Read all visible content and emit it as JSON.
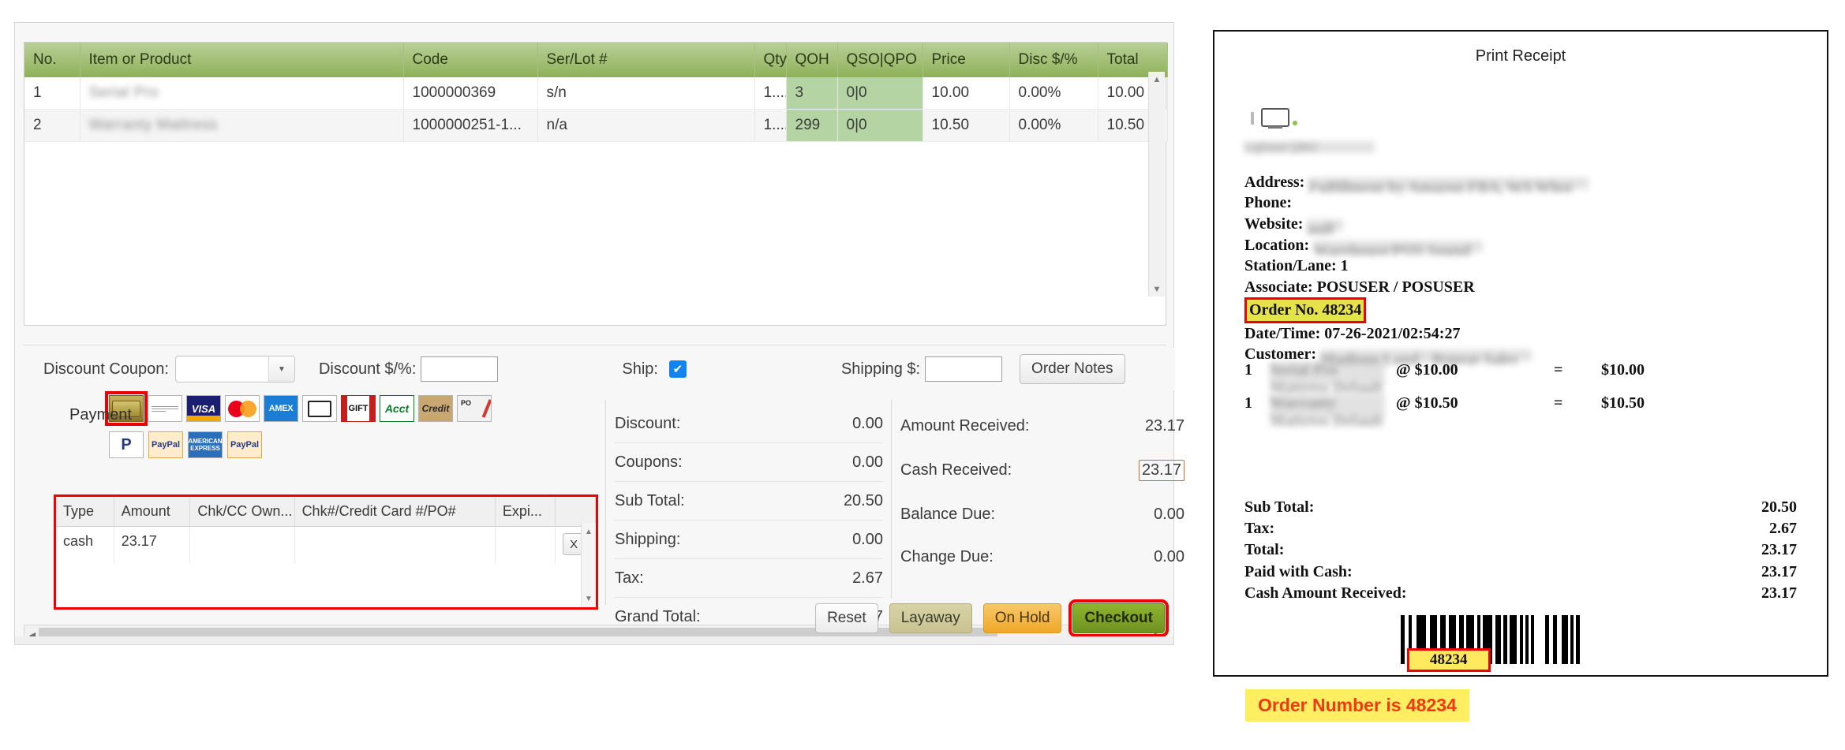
{
  "pos": {
    "items_grid": {
      "headers": [
        "No.",
        "Item or Product",
        "Code",
        "Ser/Lot #",
        "Qty",
        "QOH",
        "QSO|QPO",
        "Price",
        "Disc $/%",
        "Total"
      ],
      "rows": [
        {
          "no": "1",
          "item": "Serial Pro",
          "item_redacted": true,
          "code": "1000000369",
          "serlot": "s/n",
          "qty": "1....",
          "qoh": "3",
          "qso_qpo": "0|0",
          "price": "10.00",
          "disc": "0.00%",
          "total": "10.00"
        },
        {
          "no": "2",
          "item": "Warranty Mattress",
          "item_redacted": true,
          "code": "1000000251-1...",
          "serlot": "n/a",
          "qty": "1....",
          "qoh": "299",
          "qso_qpo": "0|0",
          "price": "10.50",
          "disc": "0.00%",
          "total": "10.50"
        }
      ]
    },
    "discount_bar": {
      "coupon_label": "Discount Coupon:",
      "coupon_value": "",
      "discount_label": "Discount $/%:",
      "discount_value": "",
      "ship_label": "Ship:",
      "ship_checked": true,
      "check_glyph": "✔",
      "shipping_label": "Shipping $:",
      "shipping_value": "",
      "order_notes_label": "Order Notes"
    },
    "payment": {
      "label": "Payment",
      "methods_row1": [
        {
          "name": "cash",
          "text": "",
          "selected": true
        },
        {
          "name": "check",
          "text": ""
        },
        {
          "name": "visa",
          "text": "VISA"
        },
        {
          "name": "mastercard",
          "text": "MasterCard"
        },
        {
          "name": "amex",
          "text": "AMEX"
        },
        {
          "name": "credit-card",
          "text": ""
        },
        {
          "name": "gift",
          "text": "GIFT"
        },
        {
          "name": "account",
          "text": "Acct"
        },
        {
          "name": "credit",
          "text": "Credit"
        },
        {
          "name": "purchase-order",
          "text": "PO"
        }
      ],
      "methods_row2": [
        {
          "name": "paypal-mark",
          "text": "P"
        },
        {
          "name": "paypal",
          "text": "PayPal"
        },
        {
          "name": "american-express",
          "text": "AMERICAN EXPRESS"
        },
        {
          "name": "paypal-credit",
          "text": "PayPal"
        }
      ]
    },
    "payment_grid": {
      "headers": [
        "Type",
        "Amount",
        "Chk/CC Own...",
        "Chk#/Credit Card #/PO#",
        "Expi...",
        ""
      ],
      "rows": [
        {
          "type": "cash",
          "amount": "23.17",
          "owner": "",
          "number": "",
          "expires": "",
          "remove": "X"
        }
      ]
    },
    "totals_left": [
      {
        "label": "Discount:",
        "value": "0.00"
      },
      {
        "label": "Coupons:",
        "value": "0.00"
      },
      {
        "label": "Sub Total:",
        "value": "20.50"
      },
      {
        "label": "Shipping:",
        "value": "0.00"
      },
      {
        "label": "Tax:",
        "value": "2.67"
      },
      {
        "label": "Grand Total:",
        "value": "23.17"
      }
    ],
    "totals_right": [
      {
        "label": "Amount Received:",
        "value": "23.17",
        "boxed": false
      },
      {
        "label": "Cash Received:",
        "value": "23.17",
        "boxed": true
      },
      {
        "label": "Balance Due:",
        "value": "0.00",
        "boxed": false
      },
      {
        "label": "Change Due:",
        "value": "0.00",
        "boxed": false
      }
    ],
    "actions": {
      "reset": "Reset",
      "layaway": "Layaway",
      "on_hold": "On Hold",
      "checkout": "Checkout"
    }
  },
  "receipt": {
    "title": "Print Receipt",
    "company_redacted": "Lighted QBO",
    "info": {
      "address_label": "Address:",
      "address_value_redacted": "Fulfillment by Amazon FBA, WA Whse",
      "phone_label": "Phone:",
      "phone_value": "",
      "website_label": "Website:",
      "website_value_redacted": "null"
    },
    "order": {
      "location_label": "Location:",
      "location_value_redacted": "Warehouse/POS Sound",
      "station_line": "Station/Lane: 1",
      "associate_line": "Associate: POSUSER / POSUSER",
      "order_no_line": "Order No. 48234",
      "datetime_line": "Date/Time: 07-26-2021/02:54:27",
      "customer_label": "Customer:",
      "customer_value_redacted": "Madison Land - Repeat Sales"
    },
    "lines": [
      {
        "qty": "1",
        "name_redacted": "Serial Pro Mattress Default",
        "at": "@ $10.00",
        "eq": "=",
        "amount": "$10.00"
      },
      {
        "qty": "1",
        "name_redacted": "Warranty Mattress Default",
        "at": "@ $10.50",
        "eq": "=",
        "amount": "$10.50"
      }
    ],
    "totals": [
      {
        "label": "Sub Total:",
        "value": "20.50"
      },
      {
        "label": "Tax:",
        "value": "2.67"
      },
      {
        "label": "Total:",
        "value": "23.17"
      },
      {
        "label": "Paid with Cash:",
        "value": "23.17"
      },
      {
        "label": "Cash Amount Received:",
        "value": "23.17"
      }
    ],
    "barcode_number": "48234"
  },
  "annotation": {
    "text": "Order Number is 48234"
  },
  "colors": {
    "header_green_top": "#b9cf98",
    "header_green_bottom": "#8fb158",
    "qoh_cell_green": "#b4d4a4",
    "highlight_red": "#ee0000",
    "annotation_bg": "#ffee62",
    "annotation_fg": "#ef3a13",
    "checkout_green": "#7ea327",
    "on_hold_orange": "#f0a828"
  }
}
